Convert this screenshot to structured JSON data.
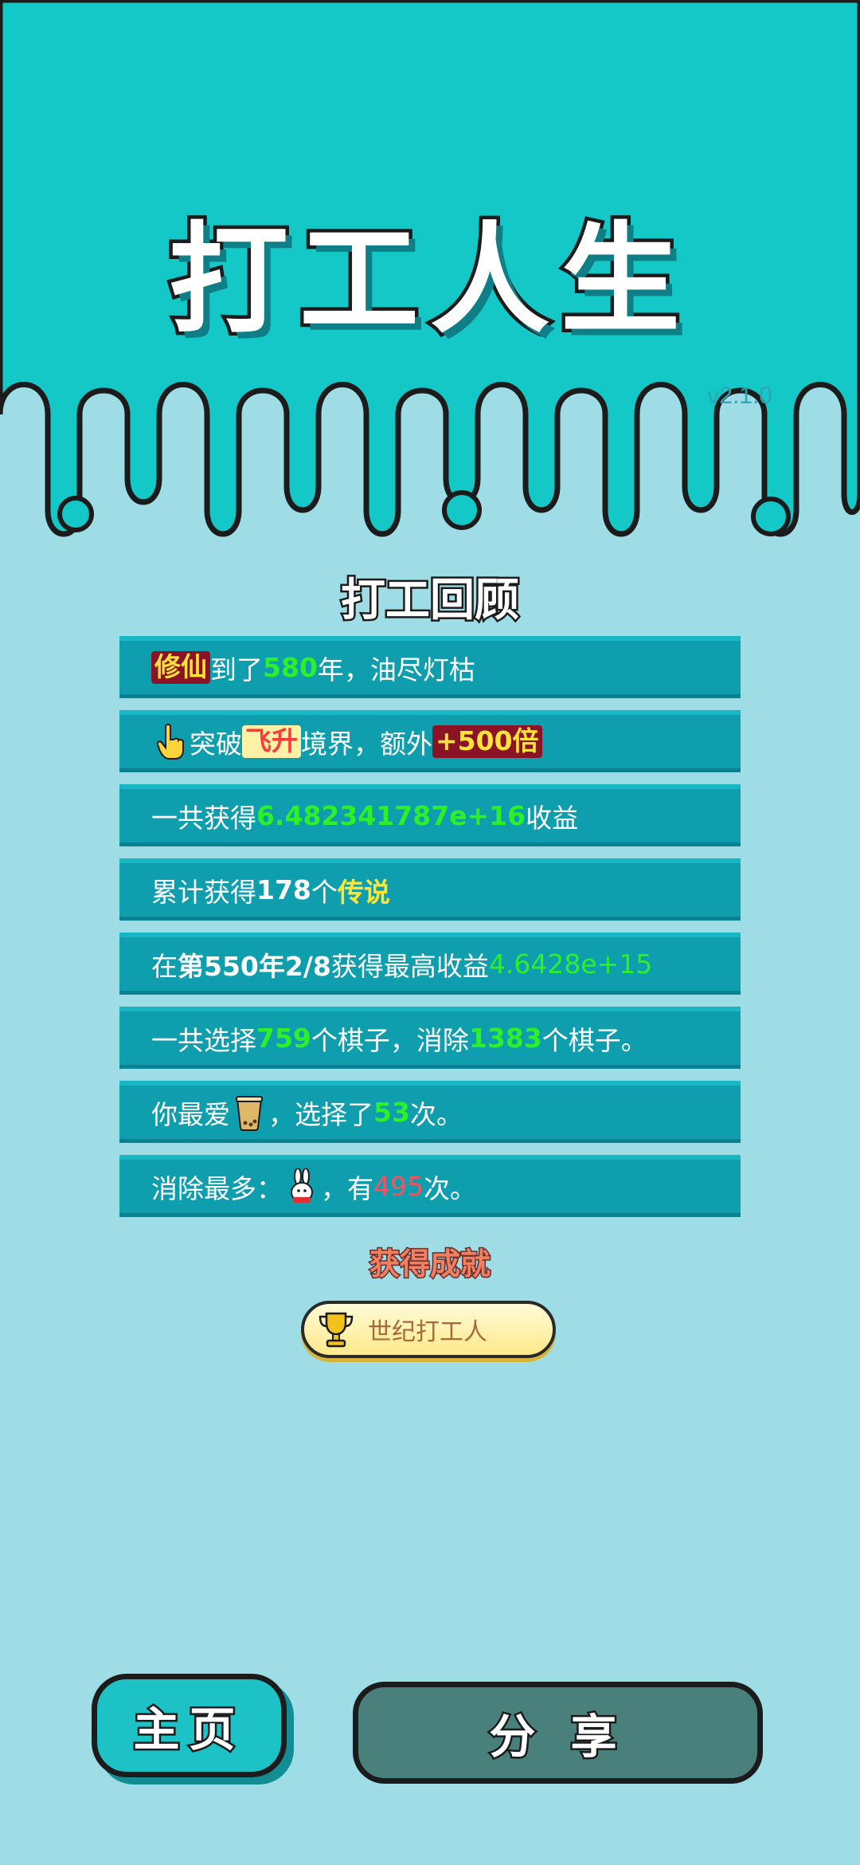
{
  "header": {
    "game_title": "打工人生",
    "version": "v2.1.0"
  },
  "review": {
    "title": "打工回顾",
    "rows": [
      {
        "tag": "修仙",
        "t1": "到了",
        "v1": "580",
        "t2": "年，油尽灯枯"
      },
      {
        "t1": "突破",
        "tag": "飞升",
        "t2": "境界，额外",
        "v1": "+500倍"
      },
      {
        "t1": "一共获得",
        "v1": "6.482341787e+16",
        "t2": "收益"
      },
      {
        "t1": "累计获得",
        "v1": "178",
        "t2": "个",
        "v2": "传说"
      },
      {
        "t1": "在 ",
        "v1": "第550年2/8",
        "t2": " 获得最高收益",
        "v2": "4.6428e+15"
      },
      {
        "t1": "一共选择",
        "v1": "759",
        "t2": "个棋子，消除",
        "v2": "1383",
        "t3": "个棋子。"
      },
      {
        "t1": "你最爱",
        "t2": "，选择了",
        "v1": "53",
        "t3": "次。"
      },
      {
        "t1": "消除最多：",
        "t2": "，有",
        "v1": "495",
        "t3": "次。"
      }
    ]
  },
  "achievements": {
    "title": "获得成就",
    "badge_label": "世纪打工人"
  },
  "buttons": {
    "home": "主页",
    "share": "分 享"
  },
  "colors": {
    "sky": "#14c8c8",
    "background": "#9fdde6",
    "row": "#0f9eae",
    "highlight_green": "#2cf028",
    "highlight_yellow": "#ffe633"
  },
  "icons": [
    "hand-pointer-icon",
    "bubble-tea-icon",
    "rabbit-icon",
    "trophy-icon"
  ]
}
